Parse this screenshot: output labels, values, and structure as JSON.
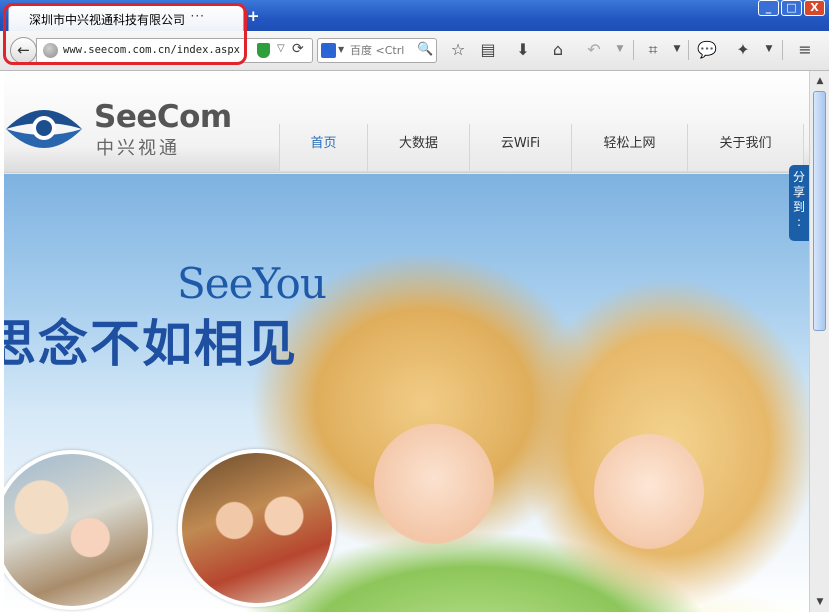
{
  "browser": {
    "tab_title": "深圳市中兴视通科技有限公司",
    "tab_close_glyph": "···",
    "new_tab_glyph": "+",
    "url": "www.seecom.com.cn/index.aspx",
    "search_engine_label": "百度",
    "search_placeholder": "百度 <Ctrl",
    "window_min": "_",
    "window_max": "□",
    "window_close": "X"
  },
  "site": {
    "logo_en": "SeeCom",
    "logo_cn": "中兴视通",
    "nav": [
      {
        "label": "首页"
      },
      {
        "label": "大数据"
      },
      {
        "label": "云WiFi"
      },
      {
        "label": "轻松上网"
      },
      {
        "label": "关于我们"
      }
    ],
    "banner_title_en": "SeeYou",
    "banner_slogan": "思念不如相见",
    "share_label": "分享到",
    "share_more": ":"
  },
  "colors": {
    "brand_blue": "#1e5aa8",
    "highlight_red": "#e0242c",
    "nav_active": "#2a6fb7"
  }
}
